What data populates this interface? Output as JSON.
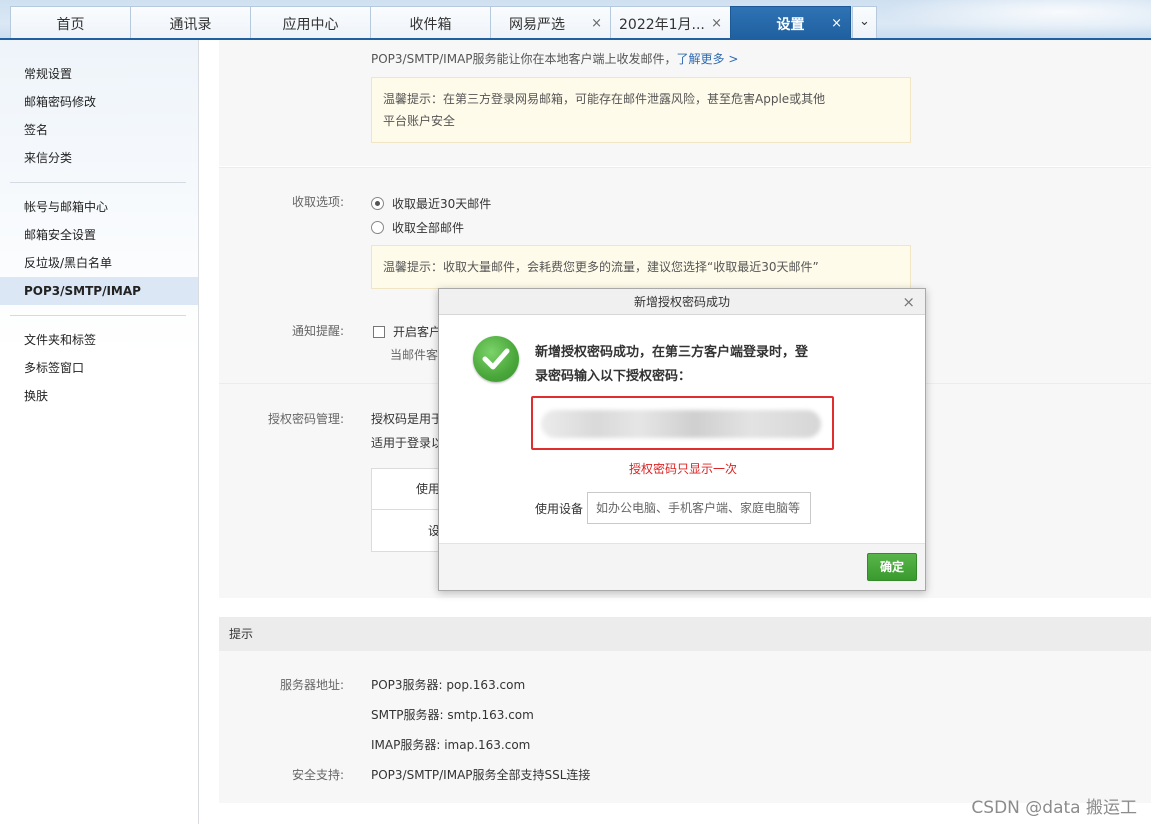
{
  "tabs": [
    {
      "label": "首页",
      "closable": false,
      "active": false
    },
    {
      "label": "通讯录",
      "closable": false,
      "active": false
    },
    {
      "label": "应用中心",
      "closable": false,
      "active": false
    },
    {
      "label": "收件箱",
      "closable": false,
      "active": false
    },
    {
      "label": "网易严选",
      "closable": true,
      "active": false
    },
    {
      "label": "2022年1月...",
      "closable": true,
      "active": false
    },
    {
      "label": "设置",
      "closable": true,
      "active": true
    }
  ],
  "tab_close_glyph": "×",
  "tab_more_glyph": "⌄",
  "sidebar": {
    "items": [
      {
        "label": "常规设置"
      },
      {
        "label": "邮箱密码修改"
      },
      {
        "label": "签名"
      },
      {
        "label": "来信分类"
      },
      {
        "label": "帐号与邮箱中心"
      },
      {
        "label": "邮箱安全设置"
      },
      {
        "label": "反垃圾/黑白名单"
      },
      {
        "label": "POP3/SMTP/IMAP"
      },
      {
        "label": "文件夹和标签"
      },
      {
        "label": "多标签窗口"
      },
      {
        "label": "换肤"
      }
    ],
    "active_item": "POP3/SMTP/IMAP"
  },
  "service_section": {
    "intro": "POP3/SMTP/IMAP服务能让你在本地客户端上收发邮件，",
    "learn_more": "了解更多 >",
    "tip_line1": "温馨提示：在第三方登录网易邮箱，可能存在邮件泄露风险，甚至危害Apple或其他",
    "tip_line2": "平台账户安全"
  },
  "receive_section": {
    "label": "收取选项:",
    "option_recent": "收取最近30天邮件",
    "option_all": "收取全部邮件",
    "selected": "收取最近30天邮件",
    "tip": "温馨提示：收取大量邮件，会耗费您更多的流量，建议您选择“收取最近30天邮件”"
  },
  "notify_section": {
    "label": "通知提醒:",
    "checkbox_label": "开启客户",
    "sub_text": "当邮件客"
  },
  "auth_section": {
    "label": "授权密码管理:",
    "line1": "授权码是用于",
    "line2": "适用于登录以",
    "table_header": "使用",
    "table_cell": "设"
  },
  "tips_section": {
    "title": "提示",
    "server_label": "服务器地址:",
    "pop3": "POP3服务器: pop.163.com",
    "smtp": "SMTP服务器: smtp.163.com",
    "imap": "IMAP服务器: imap.163.com",
    "security_label": "安全支持:",
    "security_text": "POP3/SMTP/IMAP服务全部支持SSL连接"
  },
  "dialog": {
    "title": "新增授权密码成功",
    "close_glyph": "×",
    "icon": "check-circle-icon",
    "message_line1": "新增授权密码成功，在第三方客户端登录时，登",
    "message_line2": "录密码输入以下授权密码：",
    "code_note": "授权密码只显示一次",
    "device_label": "使用设备",
    "device_placeholder": "如办公电脑、手机客户端、家庭电脑等",
    "device_value": "",
    "ok_label": "确定"
  },
  "watermark": "CSDN @data 搬运工",
  "colors": {
    "tab_active": "#1e5f9f",
    "ok_button": "#3a9a2e",
    "code_border": "#e02d2d",
    "link": "#2f6cb3"
  }
}
